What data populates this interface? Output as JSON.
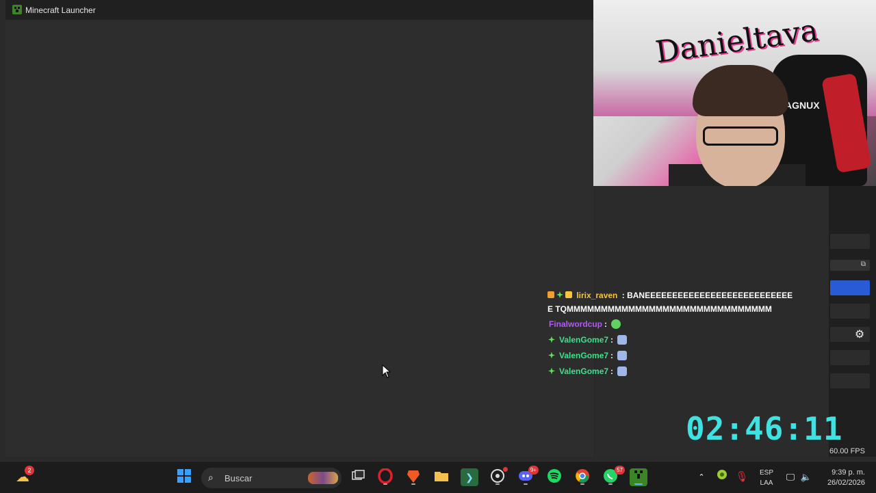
{
  "window": {
    "title": "Minecraft Launcher"
  },
  "chat": {
    "messages": [
      {
        "user": "lirix_raven",
        "sep": ":",
        "text": "BANEEEEEEEEEEEEEEEEEEEEEEEEEEEE TQMMMMMMMMMMMMMMMMMMMMMMMMMMMMMM",
        "user_color": "#f5c542"
      },
      {
        "user": "Finalwordcup",
        "sep": ":",
        "text": "",
        "user_color": "#b25af5"
      },
      {
        "user": "ValenGome7",
        "sep": ":",
        "text": "",
        "user_color": "#3fe18a"
      },
      {
        "user": "ValenGome7",
        "sep": ":",
        "text": "",
        "user_color": "#3fe18a"
      },
      {
        "user": "ValenGome7",
        "sep": ":",
        "text": "",
        "user_color": "#3fe18a"
      }
    ]
  },
  "overlay": {
    "timer": "02:46:11",
    "fps": "60.00 FPS"
  },
  "webcam": {
    "graffiti_text": "Danieltava",
    "chair_brand": "AGNUX"
  },
  "taskbar": {
    "search_placeholder": "Buscar",
    "weather_badge": "2",
    "whatsapp_badge": "57",
    "discord_badge": "9+",
    "lang_line1": "ESP",
    "lang_line2": "LAA",
    "time": "9:39 p. m.",
    "date": "26/02/2026"
  },
  "colors": {
    "accent": "#3fe1e1",
    "obs_blue": "#2a5bd7",
    "minecraft_green": "#3c8527"
  }
}
